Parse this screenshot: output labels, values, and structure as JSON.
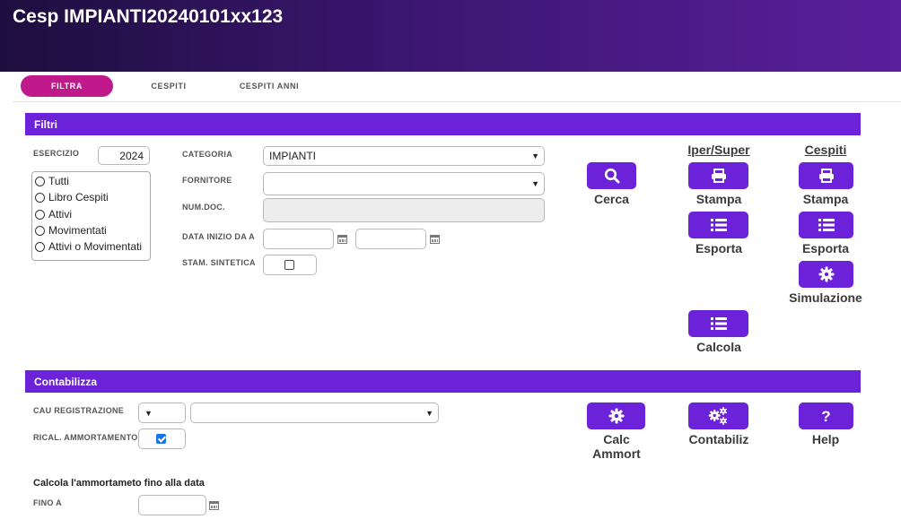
{
  "app": {
    "title": "Cesp IMPIANTI20240101xx123"
  },
  "tabs": [
    {
      "label": "FILTRA",
      "active": true
    },
    {
      "label": "CESPITI",
      "active": false
    },
    {
      "label": "CESPITI ANNI",
      "active": false
    }
  ],
  "filtri": {
    "section_title": "Filtri",
    "esercizio_label": "ESERCIZIO",
    "esercizio_value": "2024",
    "radio_options": [
      "Tutti",
      "Libro Cespiti",
      "Attivi",
      "Movimentati",
      "Attivi o Movimentati"
    ],
    "categoria_label": "CATEGORIA",
    "categoria_value": "IMPIANTI",
    "fornitore_label": "FORNITORE",
    "fornitore_value": "",
    "numdoc_label": "NUM.DOC.",
    "numdoc_value": "",
    "data_inizio_label": "DATA INIZIO DA A",
    "data_da_value": "",
    "data_a_value": "",
    "stam_sintetica_label": "STAM. SINTETICA",
    "stam_sintetica_checked": false
  },
  "actions": {
    "cerca": "Cerca",
    "iper_super_header": "Iper/Super",
    "cespiti_header": "Cespiti",
    "stampa": "Stampa",
    "esporta": "Esporta",
    "simulazione": "Simulazione",
    "calcola": "Calcola"
  },
  "contabilizza": {
    "section_title": "Contabilizza",
    "cau_label": "CAU REGISTRAZIONE",
    "cau_code_value": "",
    "cau_desc_value": "",
    "rical_label": "RICAL. AMMORTAMENTO",
    "rical_checked": true,
    "calc_ammort_line1": "Calc",
    "calc_ammort_line2": "Ammort",
    "contabiliz": "Contabiliz",
    "help": "Help",
    "subtitle": "Calcola l'ammortameto fino alla data",
    "fino_a_label": "FINO A",
    "fino_a_value": ""
  },
  "colors": {
    "header_start": "#1e0e3e",
    "header_end": "#5a1f9c",
    "accent": "#6c22d8",
    "active_tab": "#c0198c",
    "checkbox": "#1a73e8"
  },
  "icons": [
    "search-icon",
    "printer-icon",
    "list-icon",
    "gear-icon",
    "gears-icon",
    "question-icon",
    "calendar-icon",
    "chevron-down-icon"
  ]
}
